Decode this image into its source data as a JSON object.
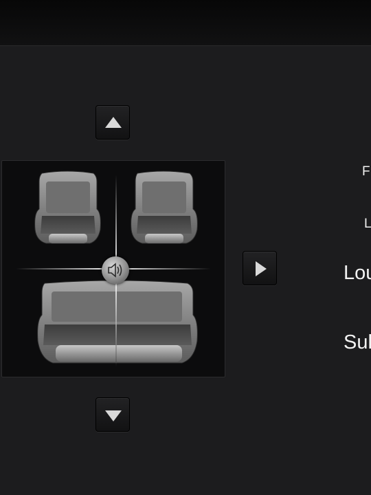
{
  "header": {
    "title": ""
  },
  "balance_pad": {
    "up_icon": "triangle-up-icon",
    "down_icon": "triangle-down-icon",
    "right_icon": "triangle-right-icon",
    "speaker_icon": "speaker-icon",
    "seats": [
      "front-left-seat",
      "front-right-seat",
      "rear-bench-seat"
    ]
  },
  "settings_labels": {
    "fader_partial": "F",
    "left_partial": "L",
    "loudness_partial": "Lou",
    "subwoofer_partial": "Sul"
  }
}
